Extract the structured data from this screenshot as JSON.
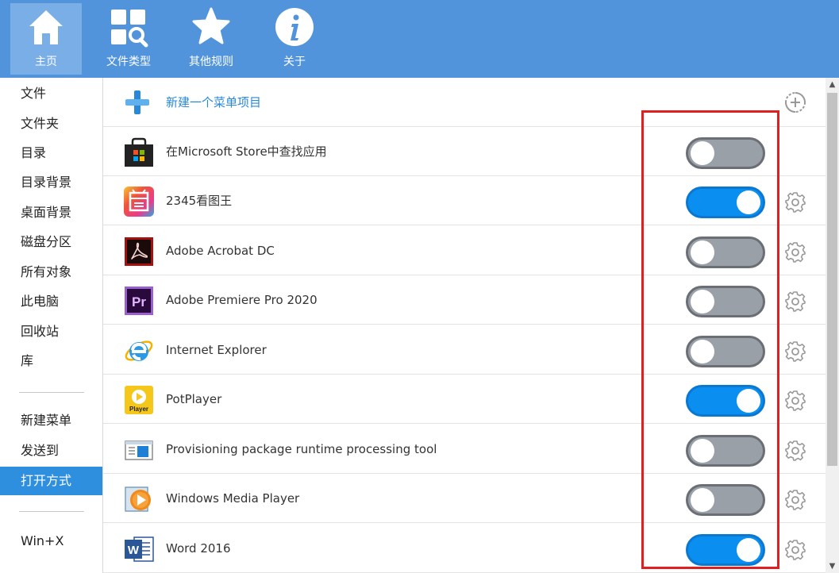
{
  "toolbar": {
    "items": [
      {
        "label": "主页",
        "icon": "home-icon"
      },
      {
        "label": "文件类型",
        "icon": "file-type-search-icon"
      },
      {
        "label": "其他规则",
        "icon": "star-icon"
      },
      {
        "label": "关于",
        "icon": "info-icon"
      }
    ]
  },
  "sidebar": {
    "items": [
      {
        "label": "文件"
      },
      {
        "label": "文件夹"
      },
      {
        "label": "目录"
      },
      {
        "label": "目录背景"
      },
      {
        "label": "桌面背景"
      },
      {
        "label": "磁盘分区"
      },
      {
        "label": "所有对象"
      },
      {
        "label": "此电脑"
      },
      {
        "label": "回收站"
      },
      {
        "label": "库"
      },
      {
        "label": "新建菜单"
      },
      {
        "label": "发送到"
      },
      {
        "label": "打开方式"
      },
      {
        "label": "Win+X"
      }
    ],
    "active": "打开方式"
  },
  "main": {
    "new_item_label": "新建一个菜单项目",
    "rows": [
      {
        "name": "在Microsoft Store中查找应用",
        "enabled": false,
        "has_settings": false,
        "icon": "microsoft-store-icon"
      },
      {
        "name": "2345看图王",
        "enabled": true,
        "has_settings": true,
        "icon": "2345-viewer-icon"
      },
      {
        "name": "Adobe Acrobat DC",
        "enabled": false,
        "has_settings": true,
        "icon": "adobe-acrobat-icon"
      },
      {
        "name": "Adobe Premiere Pro 2020",
        "enabled": false,
        "has_settings": true,
        "icon": "premiere-pro-icon"
      },
      {
        "name": "Internet Explorer",
        "enabled": false,
        "has_settings": true,
        "icon": "internet-explorer-icon"
      },
      {
        "name": "PotPlayer",
        "enabled": true,
        "has_settings": true,
        "icon": "potplayer-icon"
      },
      {
        "name": "Provisioning package runtime processing tool",
        "enabled": false,
        "has_settings": true,
        "icon": "provisioning-tool-icon"
      },
      {
        "name": "Windows Media Player",
        "enabled": false,
        "has_settings": true,
        "icon": "windows-media-player-icon"
      },
      {
        "name": "Word 2016",
        "enabled": true,
        "has_settings": true,
        "icon": "word-icon"
      }
    ]
  },
  "potplayer_icon_text": "Player",
  "premiere_icon_text": "Pr",
  "word_icon_text": "W",
  "colors": {
    "topbar": "#5294db",
    "active_sidebar": "#2e8fde",
    "toggle_on": "#0a8ef0",
    "toggle_off": "#9aa0a8",
    "highlight": "#e02020"
  }
}
